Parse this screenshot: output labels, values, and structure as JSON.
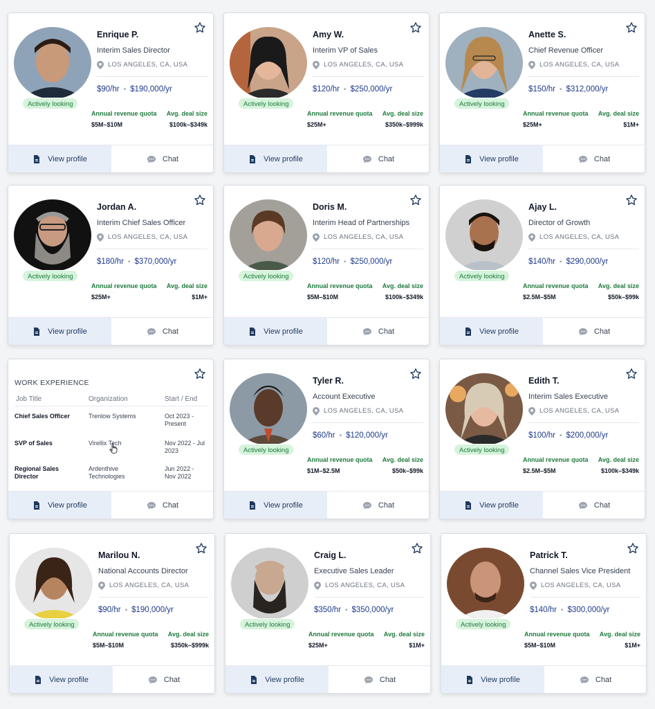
{
  "common": {
    "view_profile": "View profile",
    "chat": "Chat",
    "location": "LOS ANGELES, CA, USA",
    "badge": "Actively looking",
    "quota_label": "Annual revenue quota",
    "deal_label": "Avg. deal size",
    "dot": "•"
  },
  "colors": {
    "accent": "#1e3a8a",
    "badge_bg": "#d6f3dc",
    "badge_text": "#1d7a3a",
    "label_green": "#1f7a3d",
    "profile_btn_bg": "#e8eef8"
  },
  "cards": [
    {
      "name": "Enrique P.",
      "title": "Interim Sales Director",
      "hourly": "$90/hr",
      "yearly": "$190,000/yr",
      "quota": "$5M–$10M",
      "deal": "$100k–$349k"
    },
    {
      "name": "Amy W.",
      "title": "Interim VP of Sales",
      "hourly": "$120/hr",
      "yearly": "$250,000/yr",
      "quota": "$25M+",
      "deal": "$350k–$999k"
    },
    {
      "name": "Anette S.",
      "title": "Chief Revenue Officer",
      "hourly": "$150/hr",
      "yearly": "$312,000/yr",
      "quota": "$25M+",
      "deal": "$1M+"
    },
    {
      "name": "Jordan A.",
      "title": "Interim Chief Sales Officer",
      "hourly": "$180/hr",
      "yearly": "$370,000/yr",
      "quota": "$25M+",
      "deal": "$1M+"
    },
    {
      "name": "Doris M.",
      "title": "Interim Head of Partnerships",
      "hourly": "$120/hr",
      "yearly": "$250,000/yr",
      "quota": "$5M–$10M",
      "deal": "$100k–$349k"
    },
    {
      "name": "Ajay L.",
      "title": "Director of Growth",
      "hourly": "$140/hr",
      "yearly": "$290,000/yr",
      "quota": "$2.5M–$5M",
      "deal": "$50k–$99k"
    },
    {
      "name": "Tyler R.",
      "title": "Account Executive",
      "hourly": "$60/hr",
      "yearly": "$120,000/yr",
      "quota": "$1M–$2.5M",
      "deal": "$50k–$99k"
    },
    {
      "name": "Edith T.",
      "title": "Interim Sales Executive",
      "hourly": "$100/hr",
      "yearly": "$200,000/yr",
      "quota": "$2.5M–$5M",
      "deal": "$100k–$349k"
    },
    {
      "name": "Marilou N.",
      "title": "National Accounts Director",
      "hourly": "$90/hr",
      "yearly": "$190,000/yr",
      "quota": "$5M–$10M",
      "deal": "$350k–$999k"
    },
    {
      "name": "Craig L.",
      "title": "Executive Sales Leader",
      "hourly": "$350/hr",
      "yearly": "$350,000/yr",
      "quota": "$25M+",
      "deal": "$1M+"
    },
    {
      "name": "Patrick T.",
      "title": "Channel Sales Vice President",
      "hourly": "$140/hr",
      "yearly": "$300,000/yr",
      "quota": "$5M–$10M",
      "deal": "$1M+"
    }
  ],
  "work_experience": {
    "heading": "WORK EXPERIENCE",
    "columns": [
      "Job Title",
      "Organization",
      "Start / End"
    ],
    "rows": [
      {
        "job": "Chief Sales Officer",
        "org": "Trenlow Systems",
        "dates": "Oct 2023 - Present"
      },
      {
        "job": "SVP of Sales",
        "org": "Virellix Tech",
        "dates": "Nov 2022 - Jul 2023"
      },
      {
        "job": "Regional Sales Director",
        "org": "Ardenthive Technologies",
        "dates": "Jun 2022 - Nov 2022"
      }
    ]
  }
}
